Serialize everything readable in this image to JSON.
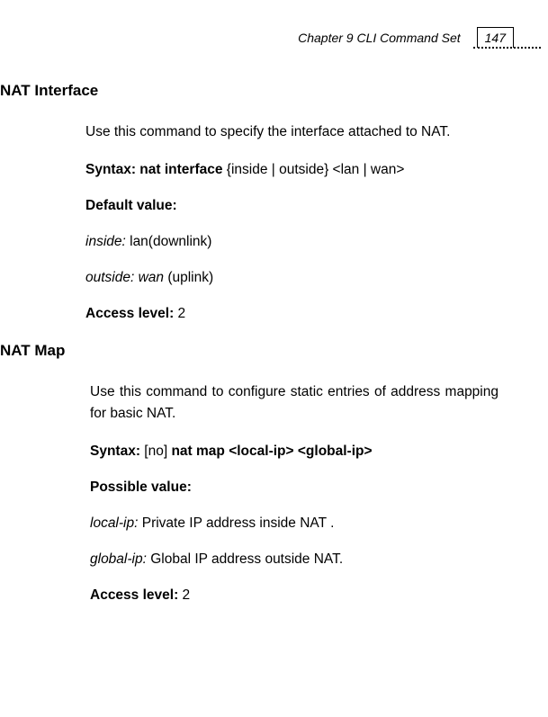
{
  "header": {
    "chapter": "Chapter 9 CLI Command Set",
    "page_number": "147"
  },
  "section1": {
    "heading": "NAT Interface",
    "intro": "Use this command to specify the interface attached to NAT.",
    "syntax_label": "Syntax: nat interface",
    "syntax_args": " {inside | outside} <lan | wan>",
    "default_label": "Default value:",
    "default1_term": "inside:",
    "default1_desc": " lan(downlink)",
    "default2_term": "outside: wan",
    "default2_desc": " (uplink)",
    "access_label": "Access level:",
    "access_value": " 2"
  },
  "section2": {
    "heading": "NAT Map",
    "intro": "Use this command to configure static entries of address mapping for basic NAT.",
    "syntax_prefix": "Syntax:",
    "syntax_mid": " [no] ",
    "syntax_bold": "nat map <local-ip> <global-ip>",
    "possible_label": "Possible value:",
    "param1_term": "local-ip:",
    "param1_desc": "  Private IP address inside NAT .",
    "param2_term": "global-ip:",
    "param2_desc": " Global IP address outside NAT.",
    "access_label": "Access level:",
    "access_value": " 2"
  }
}
